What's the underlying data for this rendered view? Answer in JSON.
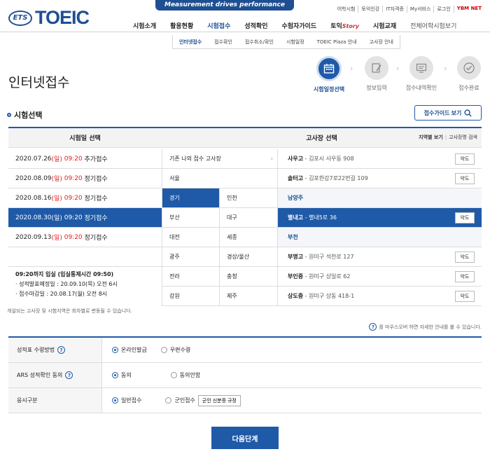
{
  "banner": "Measurement drives performance",
  "util": [
    "어학시험",
    "토익인강",
    "IT자격증",
    "My서비스",
    "로그인",
    "YBM NET"
  ],
  "logo": {
    "ets": "ETS",
    "brand": "TOEIC"
  },
  "nav": [
    "시험소개",
    "활용현황",
    "시험접수",
    "성적확인",
    "수험자가이드",
    "토익",
    "Story",
    "시험교재",
    "전체어학시험보기"
  ],
  "subnav": [
    "인터넷접수",
    "접수확인",
    "접수취소/확인",
    "시험일정",
    "TOEIC Plaza 안내",
    "고사장 안내"
  ],
  "page_title": "인터넷접수",
  "steps": [
    {
      "label": "시험일정선택",
      "icon": "calendar-icon"
    },
    {
      "label": "정보입력",
      "icon": "pencil-icon"
    },
    {
      "label": "접수내역확인",
      "icon": "monitor-icon"
    },
    {
      "label": "접수완료",
      "icon": "check-icon"
    }
  ],
  "section_title": "시험선택",
  "guide_btn": "접수가이드 보기",
  "table": {
    "date_header": "시험일 선택",
    "center_header": "고사장 선택",
    "link_region": "지역별 보기",
    "link_search": "고사장명 검색",
    "dates": [
      {
        "date": "2020.07.26",
        "day": "(일)",
        "time": "09:20",
        "type": "추가접수"
      },
      {
        "date": "2020.08.09",
        "day": "(일)",
        "time": "09:20",
        "type": "정기접수"
      },
      {
        "date": "2020.08.16",
        "day": "(일)",
        "time": "09:20",
        "type": "정기접수"
      },
      {
        "date": "2020.08.30",
        "day": "(일)",
        "time": "09:20",
        "type": "정기접수"
      },
      {
        "date": "2020.09.13",
        "day": "(일)",
        "time": "09:20",
        "type": "정기접수"
      }
    ],
    "info": [
      "09:20까지 입실 (입실통제시간 09:50)",
      "· 성적발표예정일 : 20.09.10(목) 오전 6시",
      "· 접수마감일 : 20.08.17(월) 오전 8시"
    ],
    "region_full": "기존 나의 접수 고사장",
    "regions": [
      [
        "서울",
        ""
      ],
      [
        "경기",
        "인천"
      ],
      [
        "부산",
        "대구"
      ],
      [
        "대전",
        "세종"
      ],
      [
        "광주",
        "경상/울산"
      ],
      [
        "전라",
        "충청"
      ],
      [
        "강원",
        "제주"
      ]
    ],
    "centers": [
      {
        "name": "사우고",
        "addr": " - 김포시 사우동 908",
        "btn": "약도"
      },
      {
        "name": "솔터고",
        "addr": " - 김포한강7로22번길 109",
        "btn": "약도"
      },
      {
        "group": "남양주"
      },
      {
        "name": "별내고",
        "addr": " - 별내5로 36",
        "btn": "약도"
      },
      {
        "group": "부천"
      },
      {
        "name": "부명고",
        "addr": " - 원미구 석천로 127",
        "btn": "약도"
      },
      {
        "name": "부인중",
        "addr": " - 원미구 상일로 62",
        "btn": "약도"
      },
      {
        "name": "상도중",
        "addr": " - 원미구 상동 418-1",
        "btn": "약도"
      }
    ]
  },
  "note1": "개설되는 고사장 및 시험지역은 회차별로 변동될 수 있습니다.",
  "note2": "를 마우스오버 하면 자세한 안내를 볼 수 있습니다.",
  "options": [
    {
      "label": "성적표 수령방법",
      "values": [
        "온라인발급",
        "우편수령"
      ]
    },
    {
      "label": "ARS 성적확인 동의",
      "values": [
        "동의",
        "동의안함"
      ]
    },
    {
      "label": "응시구분",
      "values": [
        "일반접수",
        "군인접수"
      ],
      "extra": "군인 신분증 규정"
    }
  ],
  "next_btn": "다음단계"
}
